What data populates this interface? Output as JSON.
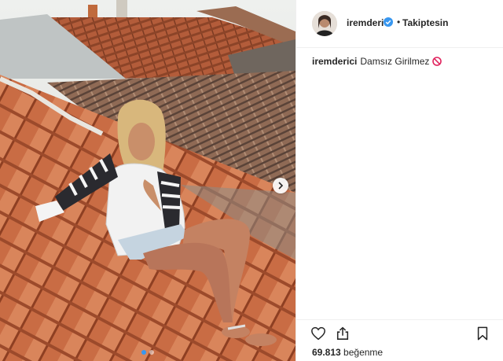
{
  "post": {
    "username": "iremderici",
    "follow_label": "Takiptesin",
    "separator": "•",
    "caption_user": "iremderici",
    "caption_text": "Damsız Girilmez",
    "caption_emoji": "no-entry-sign-icon",
    "likes_count": "69.813",
    "likes_label": "beğenme"
  },
  "icons": {
    "verified": "verified-badge-icon",
    "like": "heart-icon",
    "share": "share-icon",
    "save": "bookmark-icon",
    "next": "chevron-right-icon"
  },
  "colors": {
    "verified_blue": "#3897f0",
    "text": "#262626",
    "border": "#efefef",
    "ban_red": "#e0245e"
  },
  "photo": {
    "slides_total": 2,
    "active_slide": 1
  }
}
